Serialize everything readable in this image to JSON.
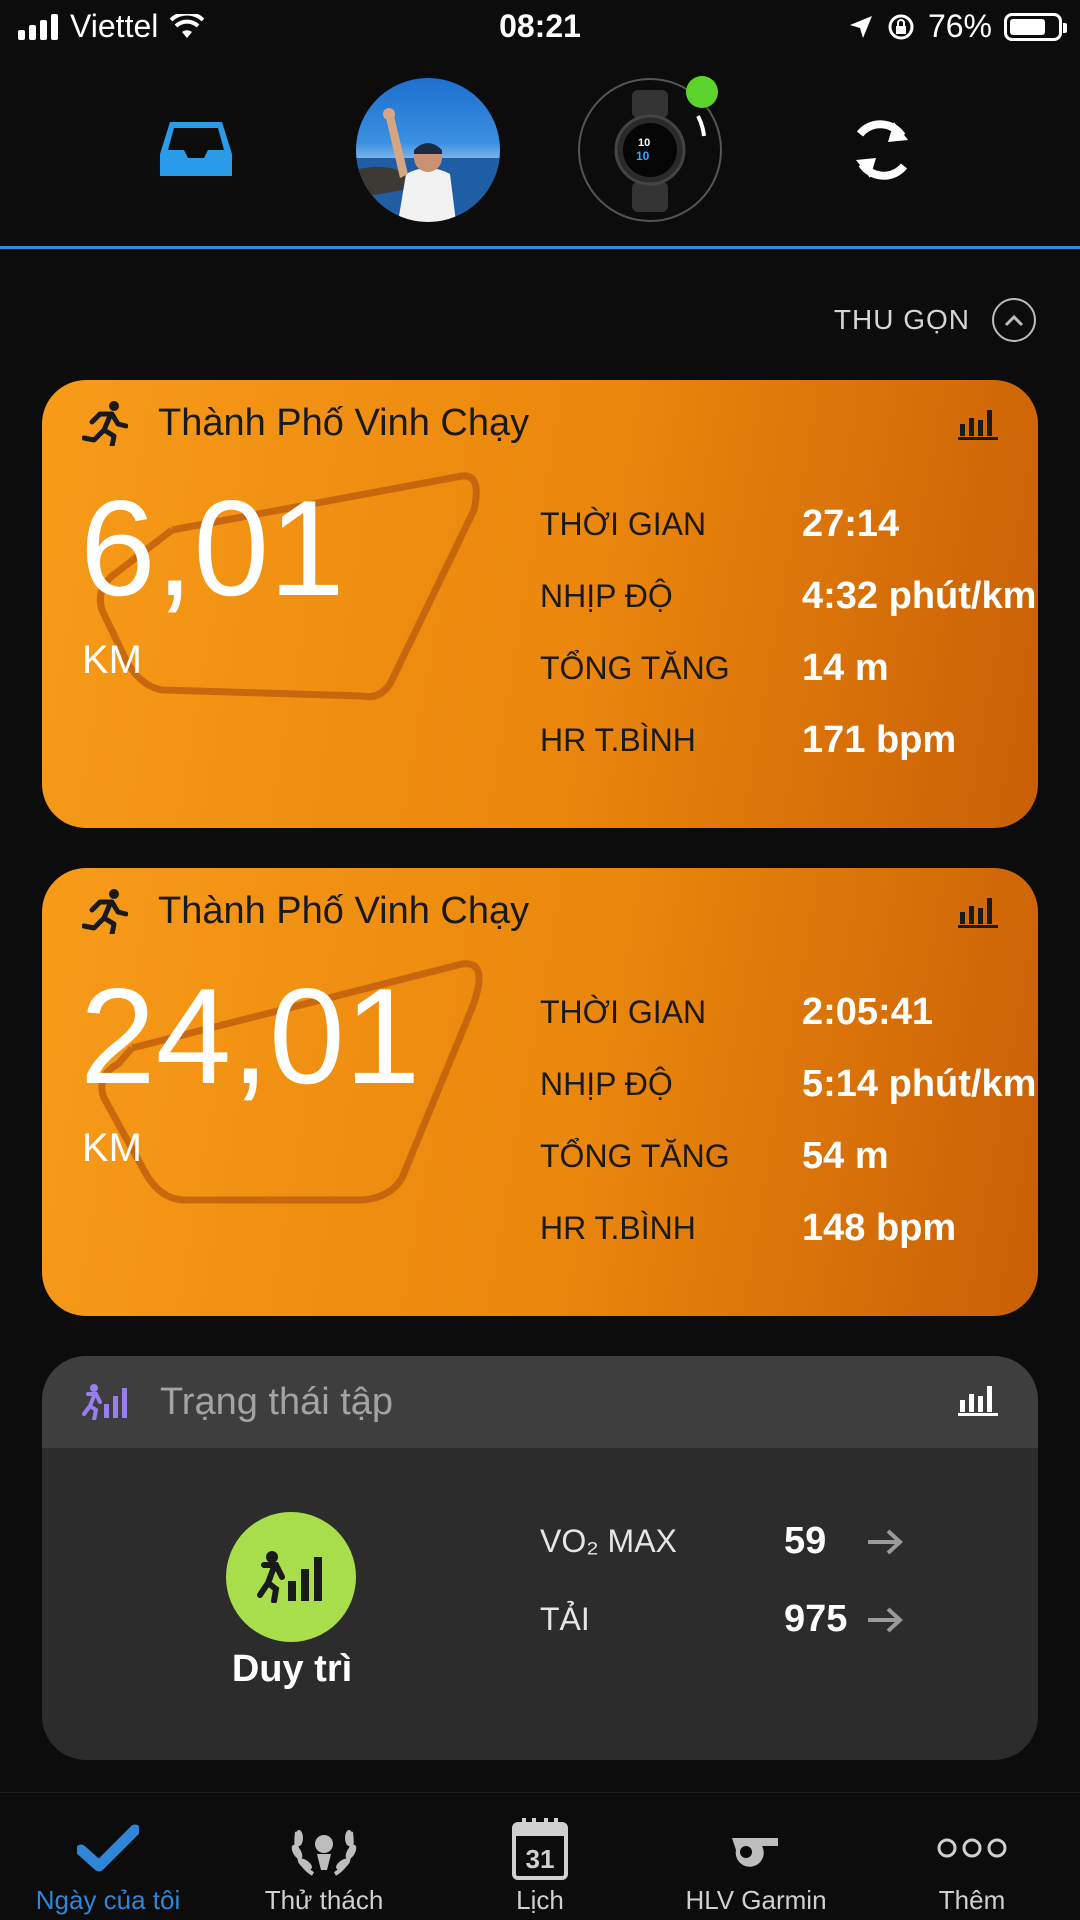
{
  "status_bar": {
    "carrier": "Viettel",
    "time": "08:21",
    "battery": "76%",
    "battery_level": 0.76
  },
  "top_nav": {
    "items": [
      "inbox-icon",
      "profile-avatar",
      "device-watch",
      "sync-icon"
    ]
  },
  "collapse": {
    "label": "THU GỌN"
  },
  "activities": [
    {
      "title": "Thành Phố Vinh Chạy",
      "distance": "6,01",
      "unit": "KM",
      "stats": [
        {
          "label": "THỜI GIAN",
          "value": "27:14"
        },
        {
          "label": "NHỊP ĐỘ",
          "value": "4:32 phút/km"
        },
        {
          "label": "TỔNG TĂNG",
          "value": "14 m"
        },
        {
          "label": "HR T.BÌNH",
          "value": "171 bpm"
        }
      ]
    },
    {
      "title": "Thành Phố Vinh Chạy",
      "distance": "24,01",
      "unit": "KM",
      "stats": [
        {
          "label": "THỜI GIAN",
          "value": "2:05:41"
        },
        {
          "label": "NHỊP ĐỘ",
          "value": "5:14 phút/km"
        },
        {
          "label": "TỔNG TĂNG",
          "value": "54 m"
        },
        {
          "label": "HR T.BÌNH",
          "value": "148 bpm"
        }
      ]
    }
  ],
  "training_status": {
    "title": "Trạng thái tập",
    "status": "Duy trì",
    "metrics": [
      {
        "label": "VO₂ MAX",
        "value": "59"
      },
      {
        "label": "TẢI",
        "value": "975"
      }
    ]
  },
  "tab_bar": {
    "tabs": [
      {
        "label": "Ngày của tôi",
        "icon": "checkmark-icon",
        "active": true
      },
      {
        "label": "Thử thách",
        "icon": "laurel-icon",
        "active": false
      },
      {
        "label": "Lịch",
        "icon": "calendar-icon",
        "calendar_day": "31",
        "active": false
      },
      {
        "label": "HLV Garmin",
        "icon": "whistle-icon",
        "active": false
      },
      {
        "label": "Thêm",
        "icon": "more-dots-icon",
        "active": false
      }
    ]
  },
  "colors": {
    "accent_blue": "#2f86d8",
    "card_orange": "#f89b19",
    "status_green": "#a8de4b",
    "training_purple": "#9a7ef0"
  }
}
